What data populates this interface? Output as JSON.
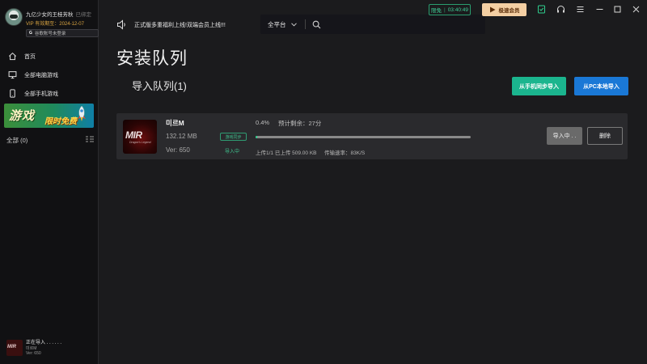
{
  "user": {
    "name": "九亿少女的王桂芳秋",
    "bound": "已绑定",
    "vip_expiry": "VIP 有效期至：2024-12-07",
    "bind_button": "谷歌账号未登录"
  },
  "sidebar": {
    "items": [
      {
        "label": "首页",
        "icon": "home-icon"
      },
      {
        "label": "全部电脑游戏",
        "icon": "monitor-icon"
      },
      {
        "label": "全部手机游戏",
        "icon": "phone-icon"
      }
    ],
    "promo": {
      "title": "游戏",
      "subtitle": "限时免费"
    },
    "all_label": "全部 (0)",
    "status": {
      "title": "正在导入 . . . . . .",
      "game": "미르M",
      "version": "Ver: 650"
    }
  },
  "topbar": {
    "notice": "正式版多重福利上线!双端会员上线!!!",
    "platform": "全平台",
    "latency_label": "限免",
    "latency_time": "03:40:49",
    "vip_button": "极速会员"
  },
  "main": {
    "title": "安装队列",
    "queue_title": "导入队列(1)",
    "btn_from_phone": "从手机同步导入",
    "btn_from_pc": "从PC本地导入"
  },
  "queue": [
    {
      "icon_logo": "MIR",
      "icon_sub": "Dragon's Legend",
      "name": "미르M",
      "size": "132.12 MB",
      "version": "Ver: 650",
      "sync_badge": "游戏同步",
      "state": "导入中",
      "percent_label": "0.4%",
      "percent_value": 0.004,
      "remaining": "预计剩余：27分",
      "upload": "上传1/1  已上传 509.00 KB",
      "speed": "传输速率：83K/S",
      "btn_importing": "导入中 . .",
      "btn_delete": "删除"
    }
  ],
  "colors": {
    "accent_green": "#1bb58e",
    "accent_blue": "#1a78d6",
    "vip_gold": "#f4cfa3",
    "background": "#1b1b1d"
  }
}
